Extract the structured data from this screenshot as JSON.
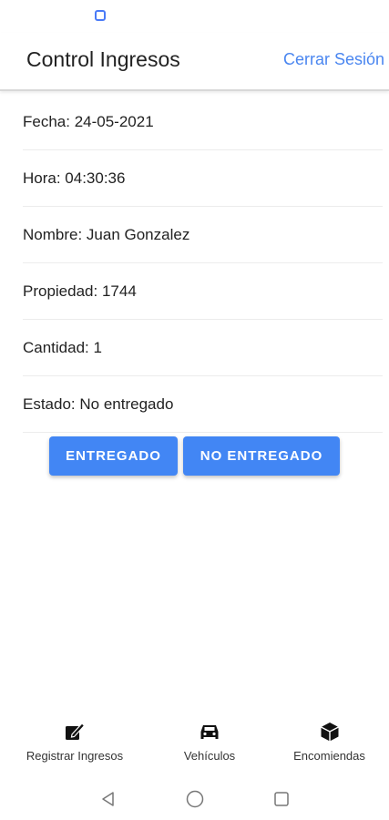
{
  "header": {
    "title": "Control Ingresos",
    "logout_label": "Cerrar Sesión"
  },
  "details": {
    "fecha": "Fecha: 24-05-2021",
    "hora": "Hora: 04:30:36",
    "nombre": "Nombre: Juan Gonzalez",
    "propiedad": "Propiedad: 1744",
    "cantidad": "Cantidad: 1",
    "estado": "Estado: No entregado"
  },
  "actions": {
    "delivered_label": "ENTREGADO",
    "not_delivered_label": "NO ENTREGADO"
  },
  "tabs": [
    {
      "label": "Registrar Ingresos",
      "icon": "edit-note-icon"
    },
    {
      "label": "Vehículos",
      "icon": "car-icon"
    },
    {
      "label": "Encomiendas",
      "icon": "package-cube-icon"
    }
  ],
  "colors": {
    "accent": "#4286f4",
    "link": "#4a86f0",
    "status_indicator": "#4a7bf7"
  }
}
